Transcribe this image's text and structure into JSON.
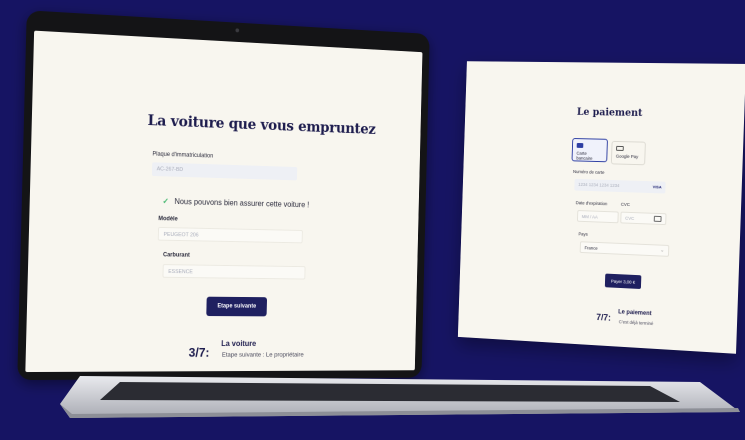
{
  "laptop": {
    "title": "La voiture que vous empruntez",
    "plate_label": "Plaque d'immatriculation",
    "plate_value": "AC-267-BD",
    "insurance_check": "Nous pouvons bien assurer cette voiture !",
    "model_label": "Modèle",
    "model_value": "PEUGEOT 206",
    "fuel_label": "Carburant",
    "fuel_value": "ESSENCE",
    "next_button": "Etape suivante",
    "step_counter": "3/7:",
    "step_title": "La voiture",
    "step_next": "Etape suivante : Le propriétaire"
  },
  "payment": {
    "title": "Le paiement",
    "tab_card": "Carte bancaire",
    "tab_gpay": "Google Pay",
    "card_number_label": "Numéro de carte",
    "card_number_placeholder": "1234 1234 1234 1234",
    "card_brand": "VISA",
    "expiry_label": "Date d'expiration",
    "expiry_placeholder": "MM / AA",
    "cvc_label": "CVC",
    "cvc_placeholder": "CVC",
    "country_label": "Pays",
    "country_value": "France",
    "pay_button": "Payer 3,00 €",
    "step_counter": "7/7:",
    "step_title": "Le paiement",
    "step_sub": "C'est déjà terminé"
  },
  "colors": {
    "background": "#161463",
    "primary": "#1f2060",
    "success": "#3eb56a",
    "screen": "#f8f6ef"
  }
}
